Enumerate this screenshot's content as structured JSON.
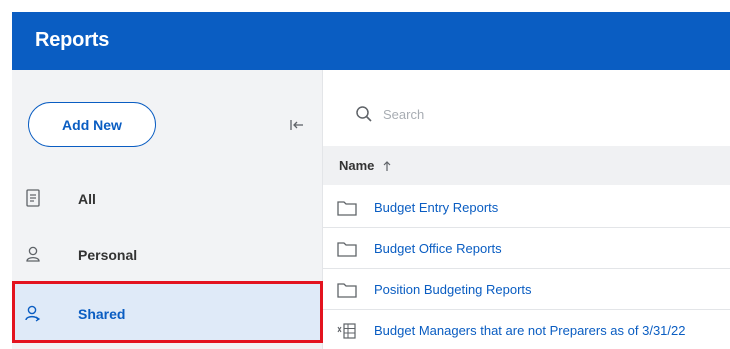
{
  "header": {
    "title": "Reports"
  },
  "sidebar": {
    "add_new_label": "Add New",
    "items": [
      {
        "label": "All",
        "icon": "document-icon"
      },
      {
        "label": "Personal",
        "icon": "person-icon"
      },
      {
        "label": "Shared",
        "icon": "shared-person-icon"
      }
    ],
    "active_item": "Shared"
  },
  "search": {
    "placeholder": "Search",
    "value": ""
  },
  "table": {
    "column_header": "Name",
    "sort": "ascending",
    "rows": [
      {
        "label": "Budget Entry Reports",
        "icon": "folder-icon"
      },
      {
        "label": "Budget Office Reports",
        "icon": "folder-icon"
      },
      {
        "label": "Position Budgeting Reports",
        "icon": "folder-icon"
      },
      {
        "label": "Budget Managers that are not Preparers as of 3/31/22",
        "icon": "spreadsheet-report-icon"
      }
    ]
  },
  "colors": {
    "brand": "#0a5dc2",
    "sidebar_bg": "#f2f3f5",
    "active_bg": "#dfeaf8",
    "highlight_outline": "#e3131f"
  }
}
